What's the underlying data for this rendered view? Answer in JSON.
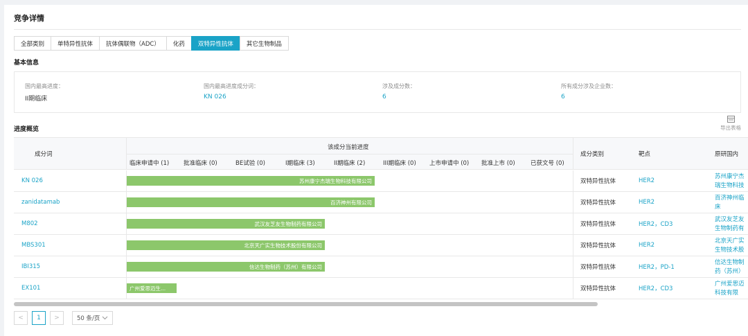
{
  "title": "竞争详情",
  "tabs": [
    {
      "label": "全部类别",
      "active": false
    },
    {
      "label": "单特异性抗体",
      "active": false
    },
    {
      "label": "抗体偶联物（ADC）",
      "active": false
    },
    {
      "label": "化药",
      "active": false
    },
    {
      "label": "双特异性抗体",
      "active": true
    },
    {
      "label": "其它生物制品",
      "active": false
    }
  ],
  "basic_info": {
    "heading": "基本信息",
    "items": [
      {
        "label": "国内最高进度：",
        "value": "II期临床"
      },
      {
        "label": "国内最高进度成分词：",
        "value": "KN 026"
      },
      {
        "label": "涉及成分数：",
        "value": "6"
      },
      {
        "label": "所有成分涉及企业数：",
        "value": "6"
      }
    ]
  },
  "progress": {
    "heading": "进度概览",
    "export_label": "导出表格",
    "headers": {
      "component": "成分词",
      "current_progress": "该成分当前进度",
      "category": "成分类别",
      "target": "靶点",
      "org": "原研国内"
    },
    "stages": [
      "临床申请中 (1)",
      "批准临床 (0)",
      "BE试验 (0)",
      "I期临床 (3)",
      "II期临床 (2)",
      "III期临床 (0)",
      "上市申请中 (0)",
      "批准上市 (0)",
      "已获文号 (0)"
    ],
    "rows": [
      {
        "component": "KN 026",
        "bar_label": "苏州康宁杰瑞生物科技有限公司",
        "stage_reached": 5,
        "category": "双特异性抗体",
        "targets": "HER2",
        "org": "苏州康宁杰瑞生物科技有限公司"
      },
      {
        "component": "zanidatamab",
        "bar_label": "百济神州有限公司",
        "stage_reached": 5,
        "category": "双特异性抗体",
        "targets": "HER2",
        "org": "百济神州临床"
      },
      {
        "component": "M802",
        "bar_label": "武汉友芝友生物制药有限公司",
        "stage_reached": 4,
        "category": "双特异性抗体",
        "targets": "HER2，CD3",
        "org": "武汉友芝友生物制药有限公司"
      },
      {
        "component": "MBS301",
        "bar_label": "北京天广实生物技术股份有限公司",
        "stage_reached": 4,
        "category": "双特异性抗体",
        "targets": "HER2",
        "org": "北京天广实生物技术股份有限"
      },
      {
        "component": "IBI315",
        "bar_label": "信达生物制药（苏州）有限公司",
        "stage_reached": 4,
        "category": "双特异性抗体",
        "targets": "HER2，PD-1",
        "org": "信达生物制药（苏州）有限"
      },
      {
        "component": "EX101",
        "bar_label": "广州爱思迈生...",
        "stage_reached": 1,
        "category": "双特异性抗体",
        "targets": "HER2，CD3",
        "org": "广州爱思迈科技有限"
      }
    ]
  },
  "pagination": {
    "prev": "<",
    "current_page": "1",
    "next": ">",
    "page_size": "50 条/页"
  }
}
